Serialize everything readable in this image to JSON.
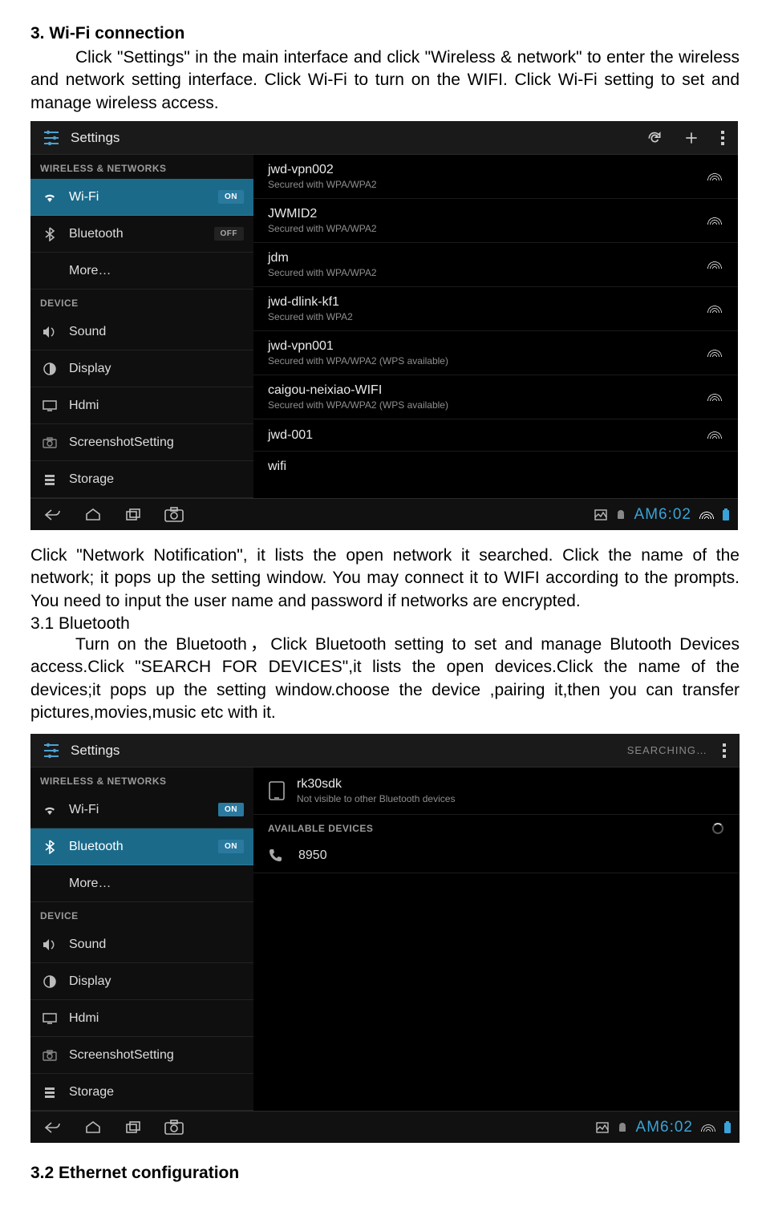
{
  "doc": {
    "h1": "3. Wi-Fi connection",
    "p1": "Click \"Settings\" in the main interface and click \"Wireless & network\" to enter the wireless and network setting interface. Click Wi-Fi to turn on the WIFI. Click Wi-Fi setting to set and manage wireless access.",
    "p2": "Click \"Network Notification\", it lists the open network it searched. Click the name of the network; it pops up the setting window. You may connect it to WIFI according to the prompts. You need to input the user name and password if networks are encrypted.",
    "h2": "3.1 Bluetooth",
    "p3": "Turn on the Bluetooth，Click Bluetooth setting to set and manage Blutooth Devices access.Click \"SEARCH FOR DEVICES\",it lists the open devices.Click the name of the devices;it pops up the setting window.choose the device ,pairing it,then you can transfer pictures,movies,music etc with it.",
    "h3": "3.2 Ethernet configuration"
  },
  "shot1": {
    "title": "Settings",
    "cats": {
      "wireless": "WIRELESS & NETWORKS",
      "device": "DEVICE"
    },
    "left": {
      "wifi": {
        "label": "Wi-Fi",
        "badge": "ON"
      },
      "bt": {
        "label": "Bluetooth",
        "badge": "OFF"
      },
      "more": {
        "label": "More…"
      },
      "sound": {
        "label": "Sound"
      },
      "display": {
        "label": "Display"
      },
      "hdmi": {
        "label": "Hdmi"
      },
      "screenshot": {
        "label": "ScreenshotSetting"
      },
      "storage": {
        "label": "Storage"
      }
    },
    "nets": [
      {
        "name": "jwd-vpn002",
        "sub": "Secured with WPA/WPA2"
      },
      {
        "name": "JWMID2",
        "sub": "Secured with WPA/WPA2"
      },
      {
        "name": "jdm",
        "sub": "Secured with WPA/WPA2"
      },
      {
        "name": "jwd-dlink-kf1",
        "sub": "Secured with WPA2"
      },
      {
        "name": "jwd-vpn001",
        "sub": "Secured with WPA/WPA2 (WPS available)"
      },
      {
        "name": "caigou-neixiao-WIFI",
        "sub": "Secured with WPA/WPA2 (WPS available)"
      },
      {
        "name": "jwd-001",
        "sub": ""
      },
      {
        "name": "wifi",
        "sub": ""
      }
    ],
    "clock": "AM6:02"
  },
  "shot2": {
    "title": "Settings",
    "searching": "SEARCHING…",
    "cats": {
      "wireless": "WIRELESS & NETWORKS",
      "device": "DEVICE"
    },
    "left": {
      "wifi": {
        "label": "Wi-Fi",
        "badge": "ON"
      },
      "bt": {
        "label": "Bluetooth",
        "badge": "ON"
      },
      "more": {
        "label": "More…"
      },
      "sound": {
        "label": "Sound"
      },
      "display": {
        "label": "Display"
      },
      "hdmi": {
        "label": "Hdmi"
      },
      "screenshot": {
        "label": "ScreenshotSetting"
      },
      "storage": {
        "label": "Storage"
      }
    },
    "self_device": {
      "name": "rk30sdk",
      "sub": "Not visible to other Bluetooth devices"
    },
    "avail_hd": "AVAILABLE DEVICES",
    "found": {
      "name": "8950"
    },
    "clock": "AM6:02"
  }
}
